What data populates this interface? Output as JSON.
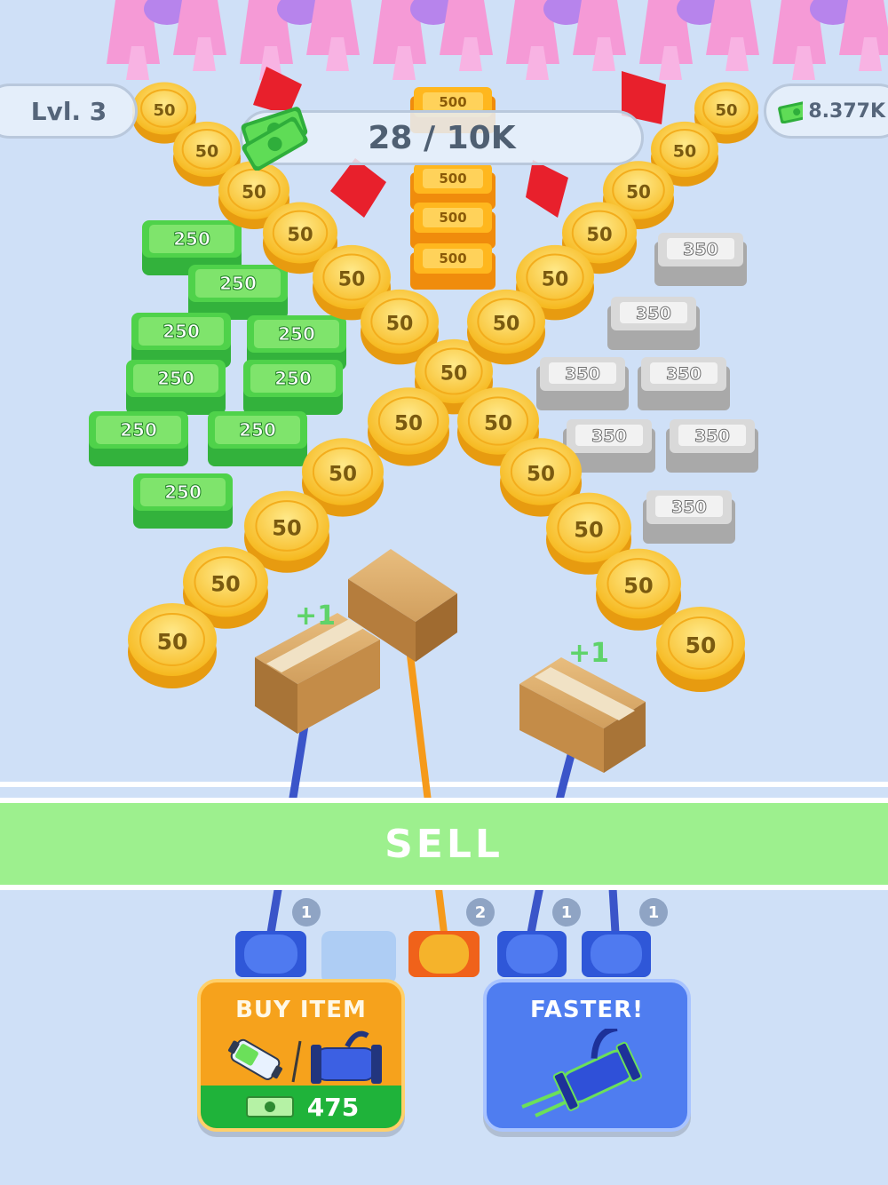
{
  "hud": {
    "level_label": "Lvl. 3",
    "progress_text": "28 / 10K",
    "money_text": "8.377K"
  },
  "board": {
    "coin_value": "50",
    "gold_bar_value": "500",
    "cash_value": "250",
    "silver_value": "350",
    "plus_one": "+1"
  },
  "sell_zone": {
    "label": "SELL"
  },
  "spools": {
    "counts": [
      "1",
      "2",
      "1",
      "1"
    ]
  },
  "buy_item_button": {
    "title": "BUY ITEM",
    "price": "475"
  },
  "faster_button": {
    "title": "FASTER!"
  },
  "colors": {
    "background": "#cfe0f7",
    "coin": "#f8c62b",
    "cash": "#4fd24a",
    "silver": "#cfcfcf",
    "gold_bar": "#ffb21c",
    "sell_band": "#9df08e",
    "buy_button": "#f6a21c",
    "faster_button": "#4f7df0"
  }
}
